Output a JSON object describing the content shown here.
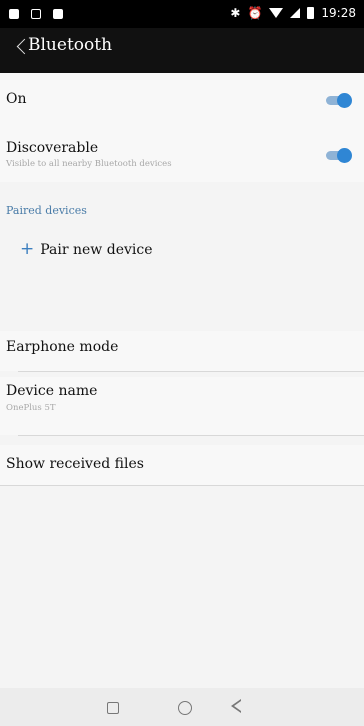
{
  "status_bar": {
    "time": "19:28",
    "left_icons": [
      "lock-icon",
      "notification-icon",
      "image-icon"
    ],
    "right_icons": [
      "bluetooth-icon",
      "alarm-icon",
      "wifi-icon",
      "signal-icon",
      "battery-icon"
    ]
  },
  "header": {
    "title": "Bluetooth",
    "back_icon": "back-arrow-icon"
  },
  "settings": {
    "on": {
      "label": "On",
      "enabled": true
    },
    "discoverable": {
      "label": "Discoverable",
      "subtitle": "Visible to all nearby Bluetooth devices",
      "enabled": true
    },
    "paired_devices": {
      "section_label": "Paired devices",
      "pair_new_label": "Pair new device"
    },
    "earphone_mode": {
      "label": "Earphone mode"
    },
    "device_name": {
      "label": "Device name",
      "value": "OnePlus 5T"
    },
    "show_received": {
      "label": "Show received files"
    }
  },
  "nav_bar": {
    "buttons": [
      "recents-square-icon",
      "home-circle-icon",
      "back-triangle-icon"
    ]
  },
  "colors": {
    "accent": "#2f86d4",
    "header_bg": "#111111",
    "section_text": "#4a7ca8"
  }
}
